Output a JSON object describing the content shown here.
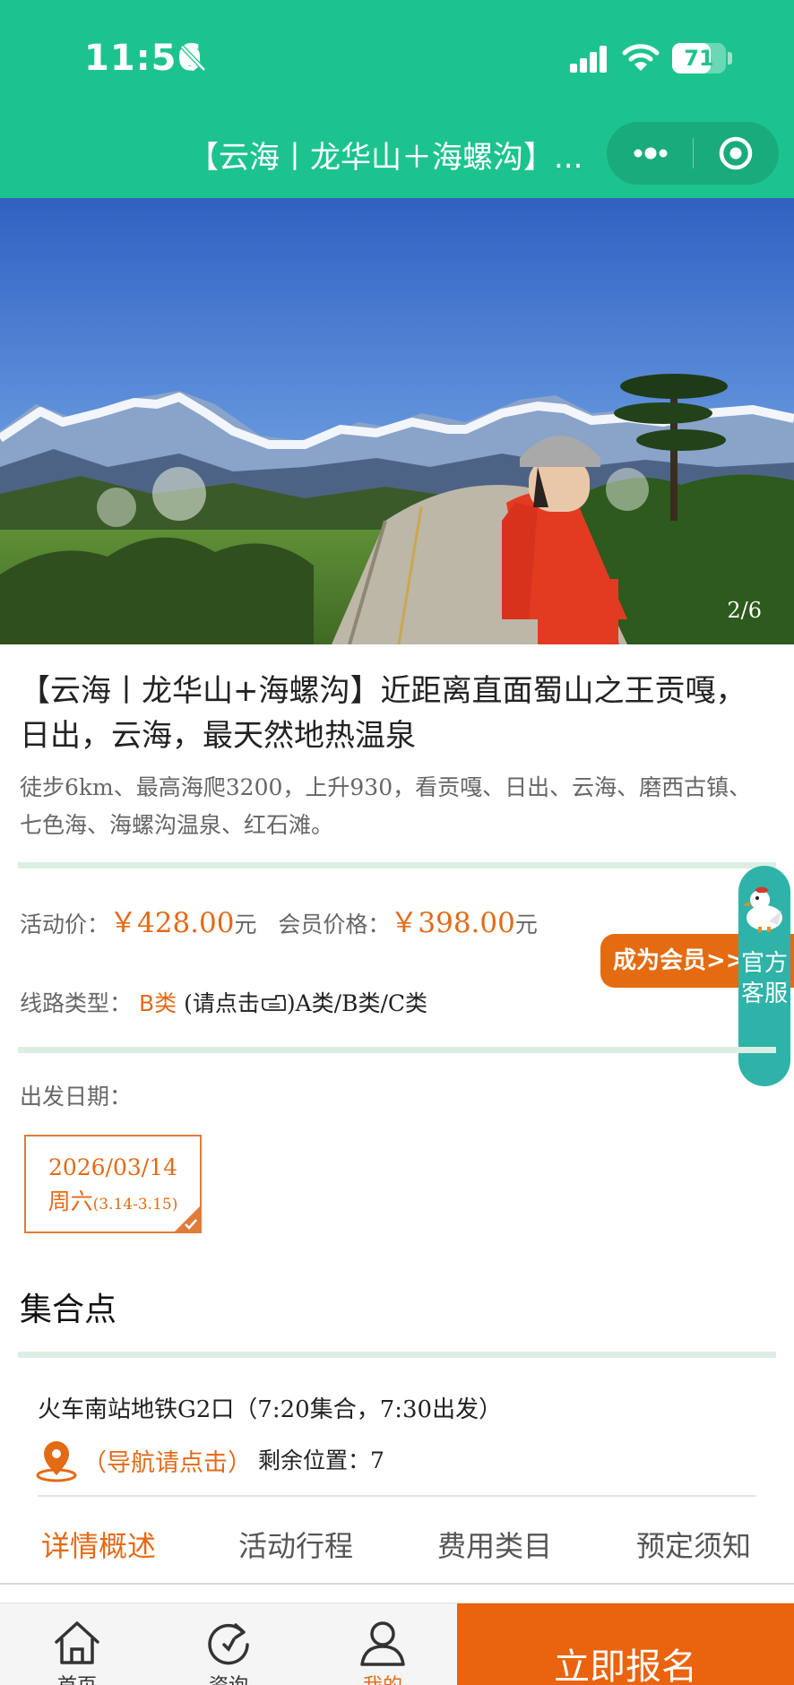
{
  "status_bar": {
    "time": "11:56",
    "battery": "71",
    "battery_level": 0.71
  },
  "nav": {
    "title": "【云海丨龙华山＋海螺沟】..."
  },
  "hero": {
    "counter": "2/6"
  },
  "activity": {
    "title": "【云海丨龙华山+海螺沟】近距离直面蜀山之王贡嘎，日出，云海，最天然地热温泉",
    "subtitle": "徒步6km、最高海爬3200，上升930，看贡嘎、日出、云海、磨西古镇、七色海、海螺沟温泉、红石滩。"
  },
  "pricing": {
    "activity_label": "活动价：",
    "activity_price": "￥428.00",
    "unit": "元",
    "member_label": "会员价格：",
    "member_price": "￥398.00",
    "member_button": "成为会员>>"
  },
  "route": {
    "label": "线路类型：",
    "value": "B类",
    "hint_open": "(请点击",
    "hint_close": ")A类/B类/C类"
  },
  "service": {
    "label": "官方客服"
  },
  "departure": {
    "label": "出发日期：",
    "date": "2026/03/14",
    "weekday": "周六",
    "range": "(3.14-3.15)"
  },
  "meeting": {
    "title": "集合点",
    "location": "火车南站地铁G2口（7:20集合，7:30出发）",
    "nav_link": "（导航请点击）",
    "remaining_label": "剩余位置：",
    "remaining_value": "7"
  },
  "tabs": [
    {
      "label": "详情概述",
      "active": true
    },
    {
      "label": "活动行程",
      "active": false
    },
    {
      "label": "费用类目",
      "active": false
    },
    {
      "label": "预定须知",
      "active": false
    }
  ],
  "bottom_nav": {
    "items": [
      {
        "label": "首页",
        "icon": "home-icon"
      },
      {
        "label": "资询",
        "icon": "refresh-icon"
      },
      {
        "label": "我的",
        "icon": "user-icon"
      }
    ],
    "signup": "立即报名"
  },
  "colors": {
    "brand_green": "#1dc38e",
    "accent_orange": "#e46a16",
    "service_teal": "#2fb3a8"
  }
}
